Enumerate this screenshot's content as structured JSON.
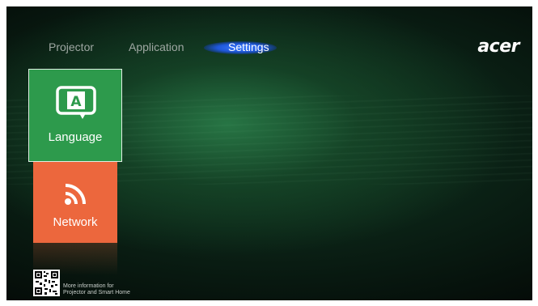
{
  "tabs": [
    {
      "label": "Projector",
      "active": false
    },
    {
      "label": "Application",
      "active": false
    },
    {
      "label": "Settings",
      "active": true
    }
  ],
  "brand": {
    "logo_text": "acer"
  },
  "tiles": [
    {
      "label": "Language",
      "icon": "language-icon",
      "color": "#2d9a4c"
    },
    {
      "label": "Network",
      "icon": "wifi-icon",
      "color": "#ec673d"
    }
  ],
  "footer": {
    "info_line1": "More information for",
    "info_line2": "Projector and Smart Home"
  },
  "colors": {
    "active_tab_glow": "#3a7bff",
    "background": "#0a1f14"
  }
}
